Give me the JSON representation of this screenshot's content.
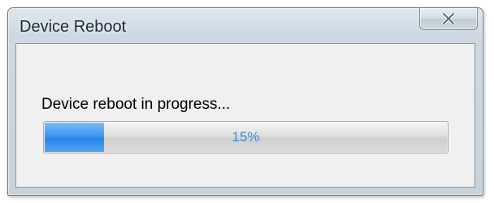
{
  "window": {
    "title": "Device Reboot",
    "close_icon": "close-icon"
  },
  "dialog": {
    "message": "Device reboot in progress...",
    "progress": {
      "value_percent": 15,
      "label": "15%",
      "fill_color": "#3c95f2",
      "text_color": "#3c8be0"
    }
  }
}
